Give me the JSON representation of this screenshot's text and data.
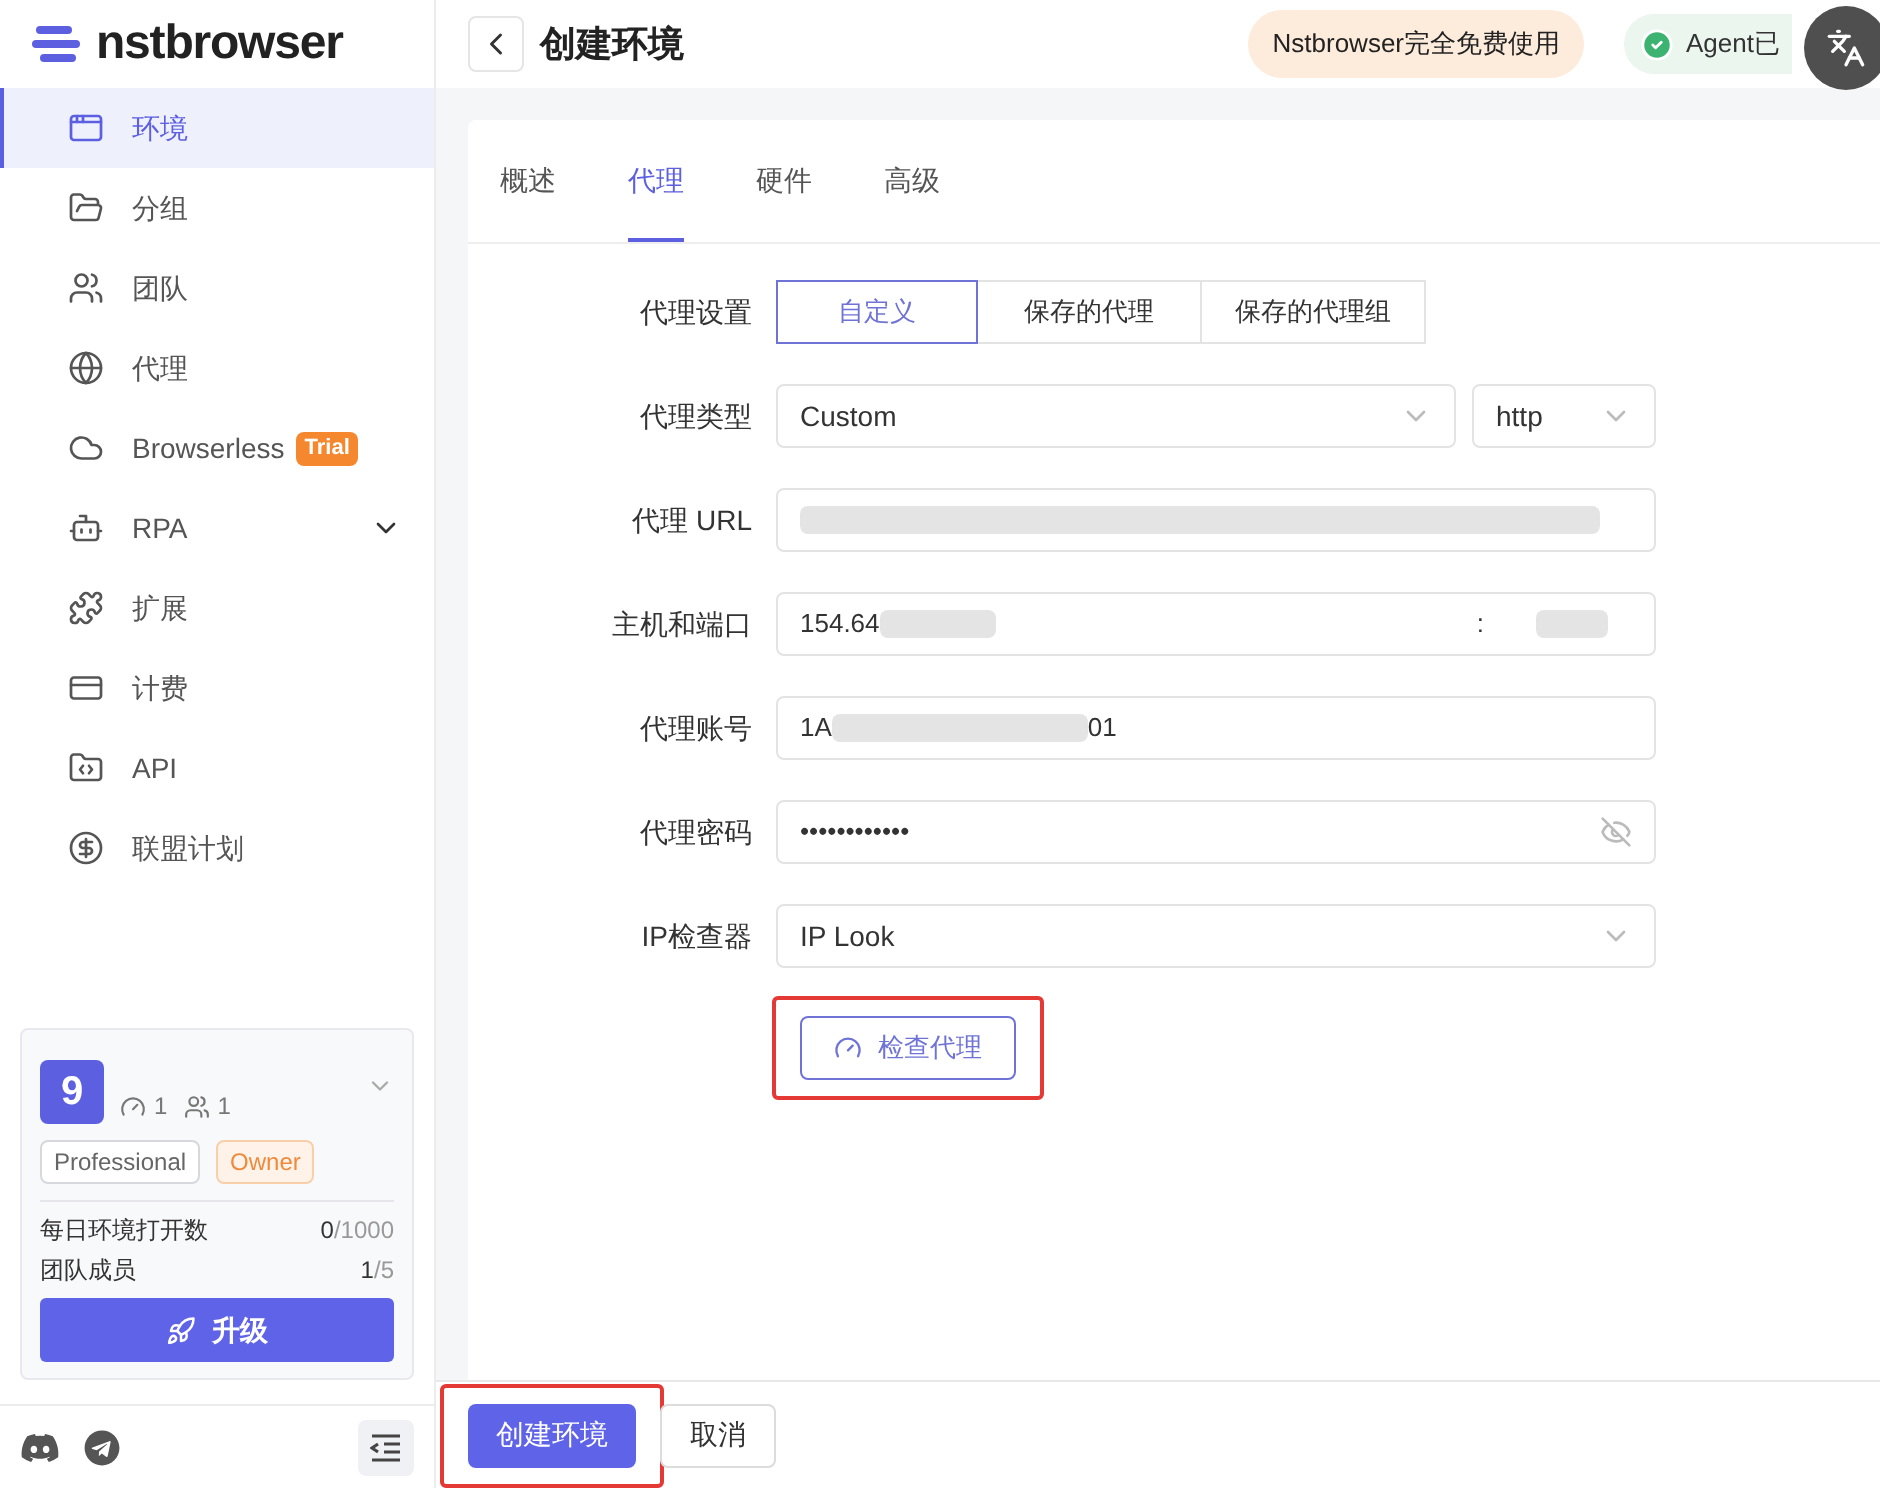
{
  "brand": {
    "name": "nstbrowser"
  },
  "sidebar": {
    "items": [
      {
        "label": "环境",
        "selected": true,
        "kind": "link"
      },
      {
        "label": "分组",
        "selected": false,
        "kind": "link"
      },
      {
        "label": "团队",
        "selected": false,
        "kind": "link"
      },
      {
        "label": "代理",
        "selected": false,
        "kind": "link"
      },
      {
        "label": "Browserless",
        "selected": false,
        "kind": "link",
        "badge": "Trial"
      },
      {
        "label": "RPA",
        "selected": false,
        "kind": "group"
      },
      {
        "label": "扩展",
        "selected": false,
        "kind": "link"
      },
      {
        "label": "计费",
        "selected": false,
        "kind": "link"
      },
      {
        "label": "API",
        "selected": false,
        "kind": "link"
      },
      {
        "label": "联盟计划",
        "selected": false,
        "kind": "link"
      }
    ]
  },
  "team_card": {
    "avatar": "9",
    "profiles": "1",
    "members": "1",
    "tags": [
      {
        "label": "Professional",
        "kind": "plan"
      },
      {
        "label": "Owner",
        "kind": "role"
      }
    ],
    "stats": [
      {
        "label": "每日环境打开数",
        "used": "0",
        "total": "/1000"
      },
      {
        "label": "团队成员",
        "used": "1",
        "total": "/5"
      }
    ],
    "upgrade": "升级"
  },
  "header": {
    "title": "创建环境",
    "promo": "Nstbrowser完全免费使用",
    "agent_status": "Agent已"
  },
  "tabs": [
    {
      "label": "概述",
      "selected": false
    },
    {
      "label": "代理",
      "selected": true
    },
    {
      "label": "硬件",
      "selected": false
    },
    {
      "label": "高级",
      "selected": false
    }
  ],
  "form": {
    "proxy_setting": {
      "label": "代理设置",
      "options": [
        {
          "label": "自定义",
          "selected": true
        },
        {
          "label": "保存的代理",
          "selected": false
        },
        {
          "label": "保存的代理组",
          "selected": false
        }
      ]
    },
    "proxy_type": {
      "label": "代理类型",
      "value": "Custom",
      "protocol": "http"
    },
    "proxy_url": {
      "label": "代理 URL"
    },
    "host_port": {
      "label": "主机和端口",
      "host": "154.64",
      "separator": ":"
    },
    "account": {
      "label": "代理账号",
      "value_start": "1A",
      "value_end": "01"
    },
    "password": {
      "label": "代理密码",
      "value": "••••••••••••"
    },
    "ip_checker": {
      "label": "IP检查器",
      "value": "IP Look"
    },
    "check_button": {
      "label": "检查代理",
      "highlighted": true
    }
  },
  "footer": {
    "buttons": [
      {
        "label": "创建环境",
        "kind": "primary",
        "highlighted": true
      },
      {
        "label": "取消",
        "kind": "secondary",
        "highlighted": false
      }
    ]
  }
}
